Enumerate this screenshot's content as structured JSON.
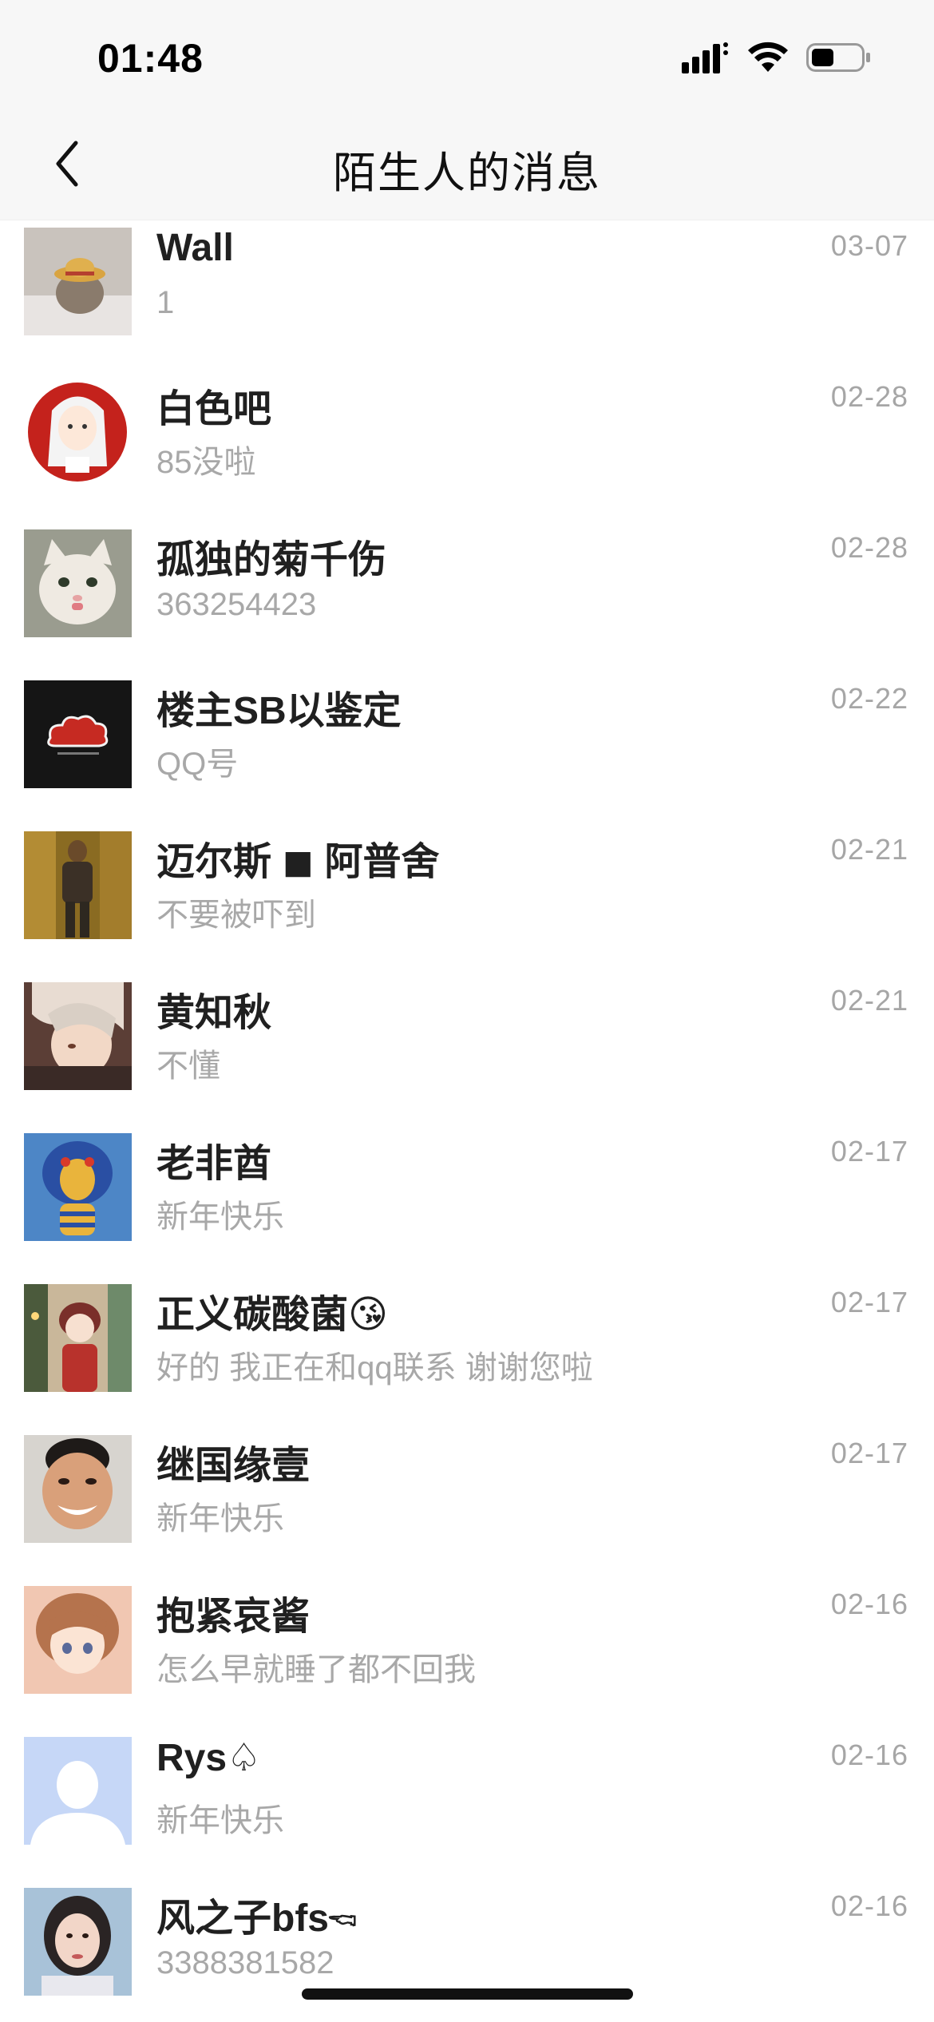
{
  "status_bar": {
    "time": "01:48",
    "signal_icon": "cellular-signal-icon",
    "wifi_icon": "wifi-icon",
    "battery_icon": "battery-icon",
    "battery_level": 0.45
  },
  "nav": {
    "back_icon": "chevron-left-icon",
    "title": "陌生人的消息"
  },
  "conversations": [
    {
      "name": "Wall",
      "preview": "1",
      "date": "03-07",
      "avatar": "cat-with-straw-hat-avatar"
    },
    {
      "name": "白色吧",
      "preview": "85没啦",
      "date": "02-28",
      "avatar": "anime-girl-red-circle-avatar"
    },
    {
      "name": "孤独的菊千伤",
      "preview": "363254423",
      "date": "02-28",
      "avatar": "white-cat-avatar"
    },
    {
      "name": "楼主SB以鉴定",
      "preview": "QQ号",
      "date": "02-22",
      "avatar": "akatsuki-cloud-avatar"
    },
    {
      "name": "迈尔斯 ◼ 阿普舍",
      "preview": "不要被吓到",
      "date": "02-21",
      "avatar": "gold-figure-avatar"
    },
    {
      "name": "黄知秋",
      "preview": "不懂",
      "date": "02-21",
      "avatar": "anime-boy-avatar"
    },
    {
      "name": "老非酋",
      "preview": "新年快乐",
      "date": "02-17",
      "avatar": "cobra-figure-avatar"
    },
    {
      "name": "正义碳酸菌😘",
      "preview": "好的 我正在和qq联系 谢谢您啦",
      "date": "02-17",
      "avatar": "anime-girl-street-avatar"
    },
    {
      "name": "继国缘壹",
      "preview": "新年快乐",
      "date": "02-17",
      "avatar": "boy-photo-avatar"
    },
    {
      "name": "抱紧哀酱",
      "preview": "怎么早就睡了都不回我",
      "date": "02-16",
      "avatar": "anime-girl-brown-hair-avatar"
    },
    {
      "name": "Rys♤",
      "preview": "新年快乐",
      "date": "02-16",
      "avatar": "default-user-avatar"
    },
    {
      "name": "风之子bfs🖘",
      "preview": "3388381582",
      "date": "02-16",
      "avatar": "girl-photo-avatar"
    }
  ]
}
